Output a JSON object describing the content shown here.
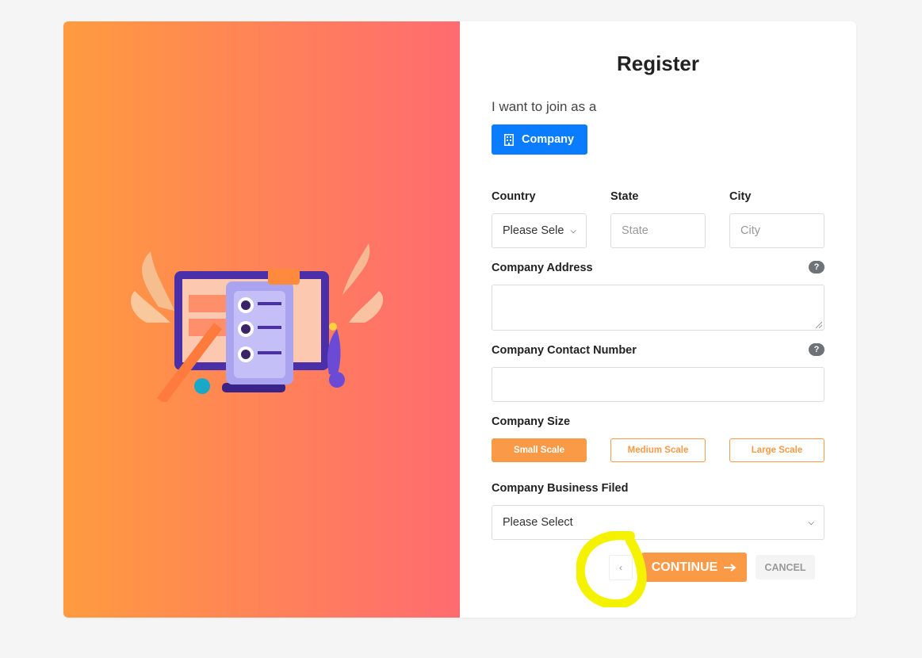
{
  "form": {
    "title": "Register",
    "join_label": "I want to join as a",
    "join_option": "Company",
    "country": {
      "label": "Country",
      "value": "Please Sele"
    },
    "state": {
      "label": "State",
      "placeholder": "State"
    },
    "city": {
      "label": "City",
      "placeholder": "City"
    },
    "address": {
      "label": "Company Address",
      "help": "?"
    },
    "contact": {
      "label": "Company Contact Number",
      "help": "?"
    },
    "size": {
      "label": "Company Size",
      "options": [
        "Small Scale",
        "Medium Scale",
        "Large Scale"
      ],
      "selected": "Small Scale"
    },
    "business": {
      "label": "Company Business Filed",
      "value": "Please Select"
    },
    "actions": {
      "back": "‹",
      "continue": "CONTINUE",
      "cancel": "CANCEL"
    }
  },
  "colors": {
    "gradient_start": "#ff9b3f",
    "gradient_end": "#ff6b70",
    "primary_blue": "#0a7cff",
    "accent_orange": "#fa9a47",
    "highlight_yellow": "#f5f200"
  },
  "icons": {
    "company": "building-icon",
    "continue": "arrow-right-icon",
    "back": "chevron-left-icon"
  }
}
